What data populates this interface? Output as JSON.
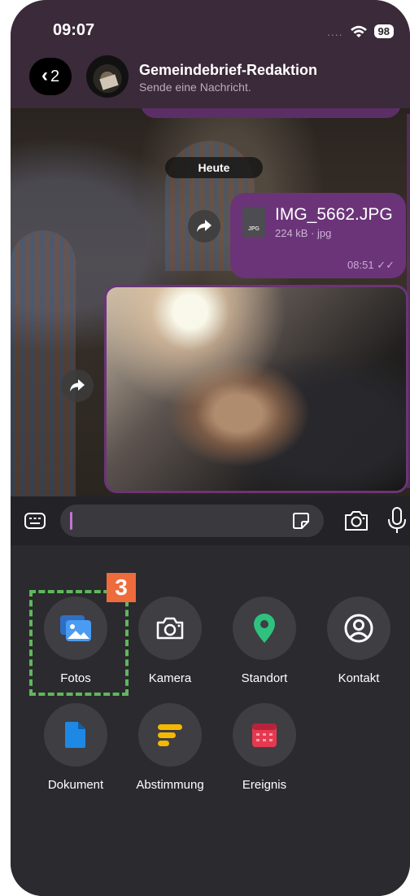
{
  "status_bar": {
    "time": "09:07",
    "signal": "....",
    "battery": "98"
  },
  "header": {
    "back_count": "2",
    "title": "Gemeindebrief-Redaktion",
    "subtitle": "Sende eine Nachricht."
  },
  "chat": {
    "date_separator": "Heute",
    "file_message": {
      "file_type_label": "JPG",
      "name": "IMG_5662.JPG",
      "meta": "224 kB · jpg",
      "time": "08:51",
      "read_marker": "✓✓"
    }
  },
  "composer": {
    "placeholder": ""
  },
  "attach_menu": {
    "annotation_badge": "3",
    "items": [
      {
        "label": "Fotos",
        "icon": "photos-icon",
        "color": "#3c8ee8"
      },
      {
        "label": "Kamera",
        "icon": "camera-icon",
        "color": "#ffffff"
      },
      {
        "label": "Standort",
        "icon": "location-pin-icon",
        "color": "#2ec27e"
      },
      {
        "label": "Kontakt",
        "icon": "contact-icon",
        "color": "#ffffff"
      },
      {
        "label": "Dokument",
        "icon": "document-icon",
        "color": "#1e88e5"
      },
      {
        "label": "Abstimmung",
        "icon": "poll-icon",
        "color": "#f5b800"
      },
      {
        "label": "Ereignis",
        "icon": "calendar-icon",
        "color": "#e53950"
      }
    ]
  },
  "colors": {
    "header": "#3b2a3a",
    "bubble": "#6b3479",
    "panel": "#2b2a2e",
    "highlight": "#5fb85a",
    "badge": "#ee6b3c"
  }
}
